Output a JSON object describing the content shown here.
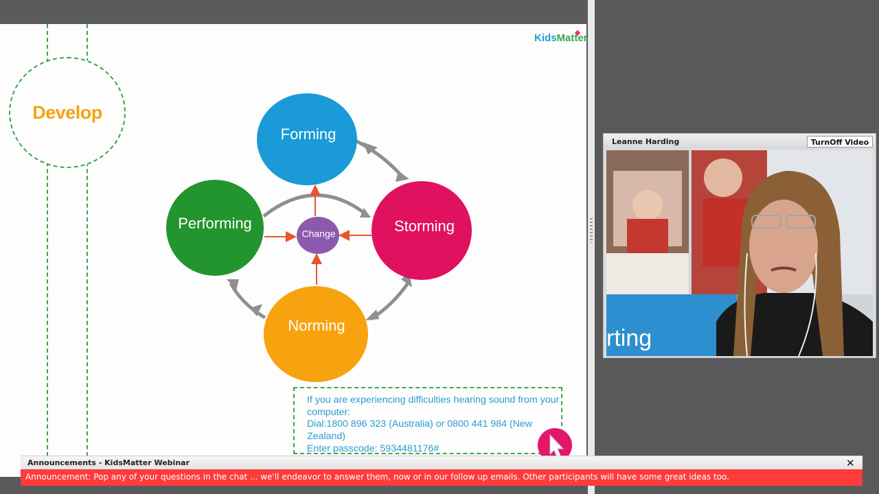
{
  "slide": {
    "section_label": "Develop",
    "logo_text": {
      "part1": "Kids",
      "part2": "Matter"
    },
    "stages": {
      "forming": "Forming",
      "storming": "Storming",
      "norming": "Norming",
      "performing": "Performing",
      "center": "Change"
    },
    "colors": {
      "forming": "#1a9ad6",
      "storming": "#e0115f",
      "norming": "#f7a20f",
      "performing": "#23952e",
      "center": "#8c5aad",
      "arrow_red": "#e8542c",
      "arrow_gray": "#8f8f8f",
      "dashed_green": "#3aa64a"
    },
    "info_box": {
      "line1": "If you are experiencing difficulties hearing sound from your",
      "line2": "computer:",
      "line3": "Dial:1800 896 323 (Australia) or 0800 441 984 (New",
      "line4": "Zealand)",
      "line5": "Enter passcode: 5934481176#"
    }
  },
  "video": {
    "presenter_name": "Leanne Harding",
    "toggle_button_label": "TurnOff Video",
    "banner_text": "rting"
  },
  "announcements": {
    "title": "Announcements - KidsMatter Webinar",
    "close_label": "✕",
    "message": "Announcement: Pop any of your questions in the chat ... we'll endeavor to answer them, now or in our follow up emails. Other participants will have some great ideas too."
  }
}
